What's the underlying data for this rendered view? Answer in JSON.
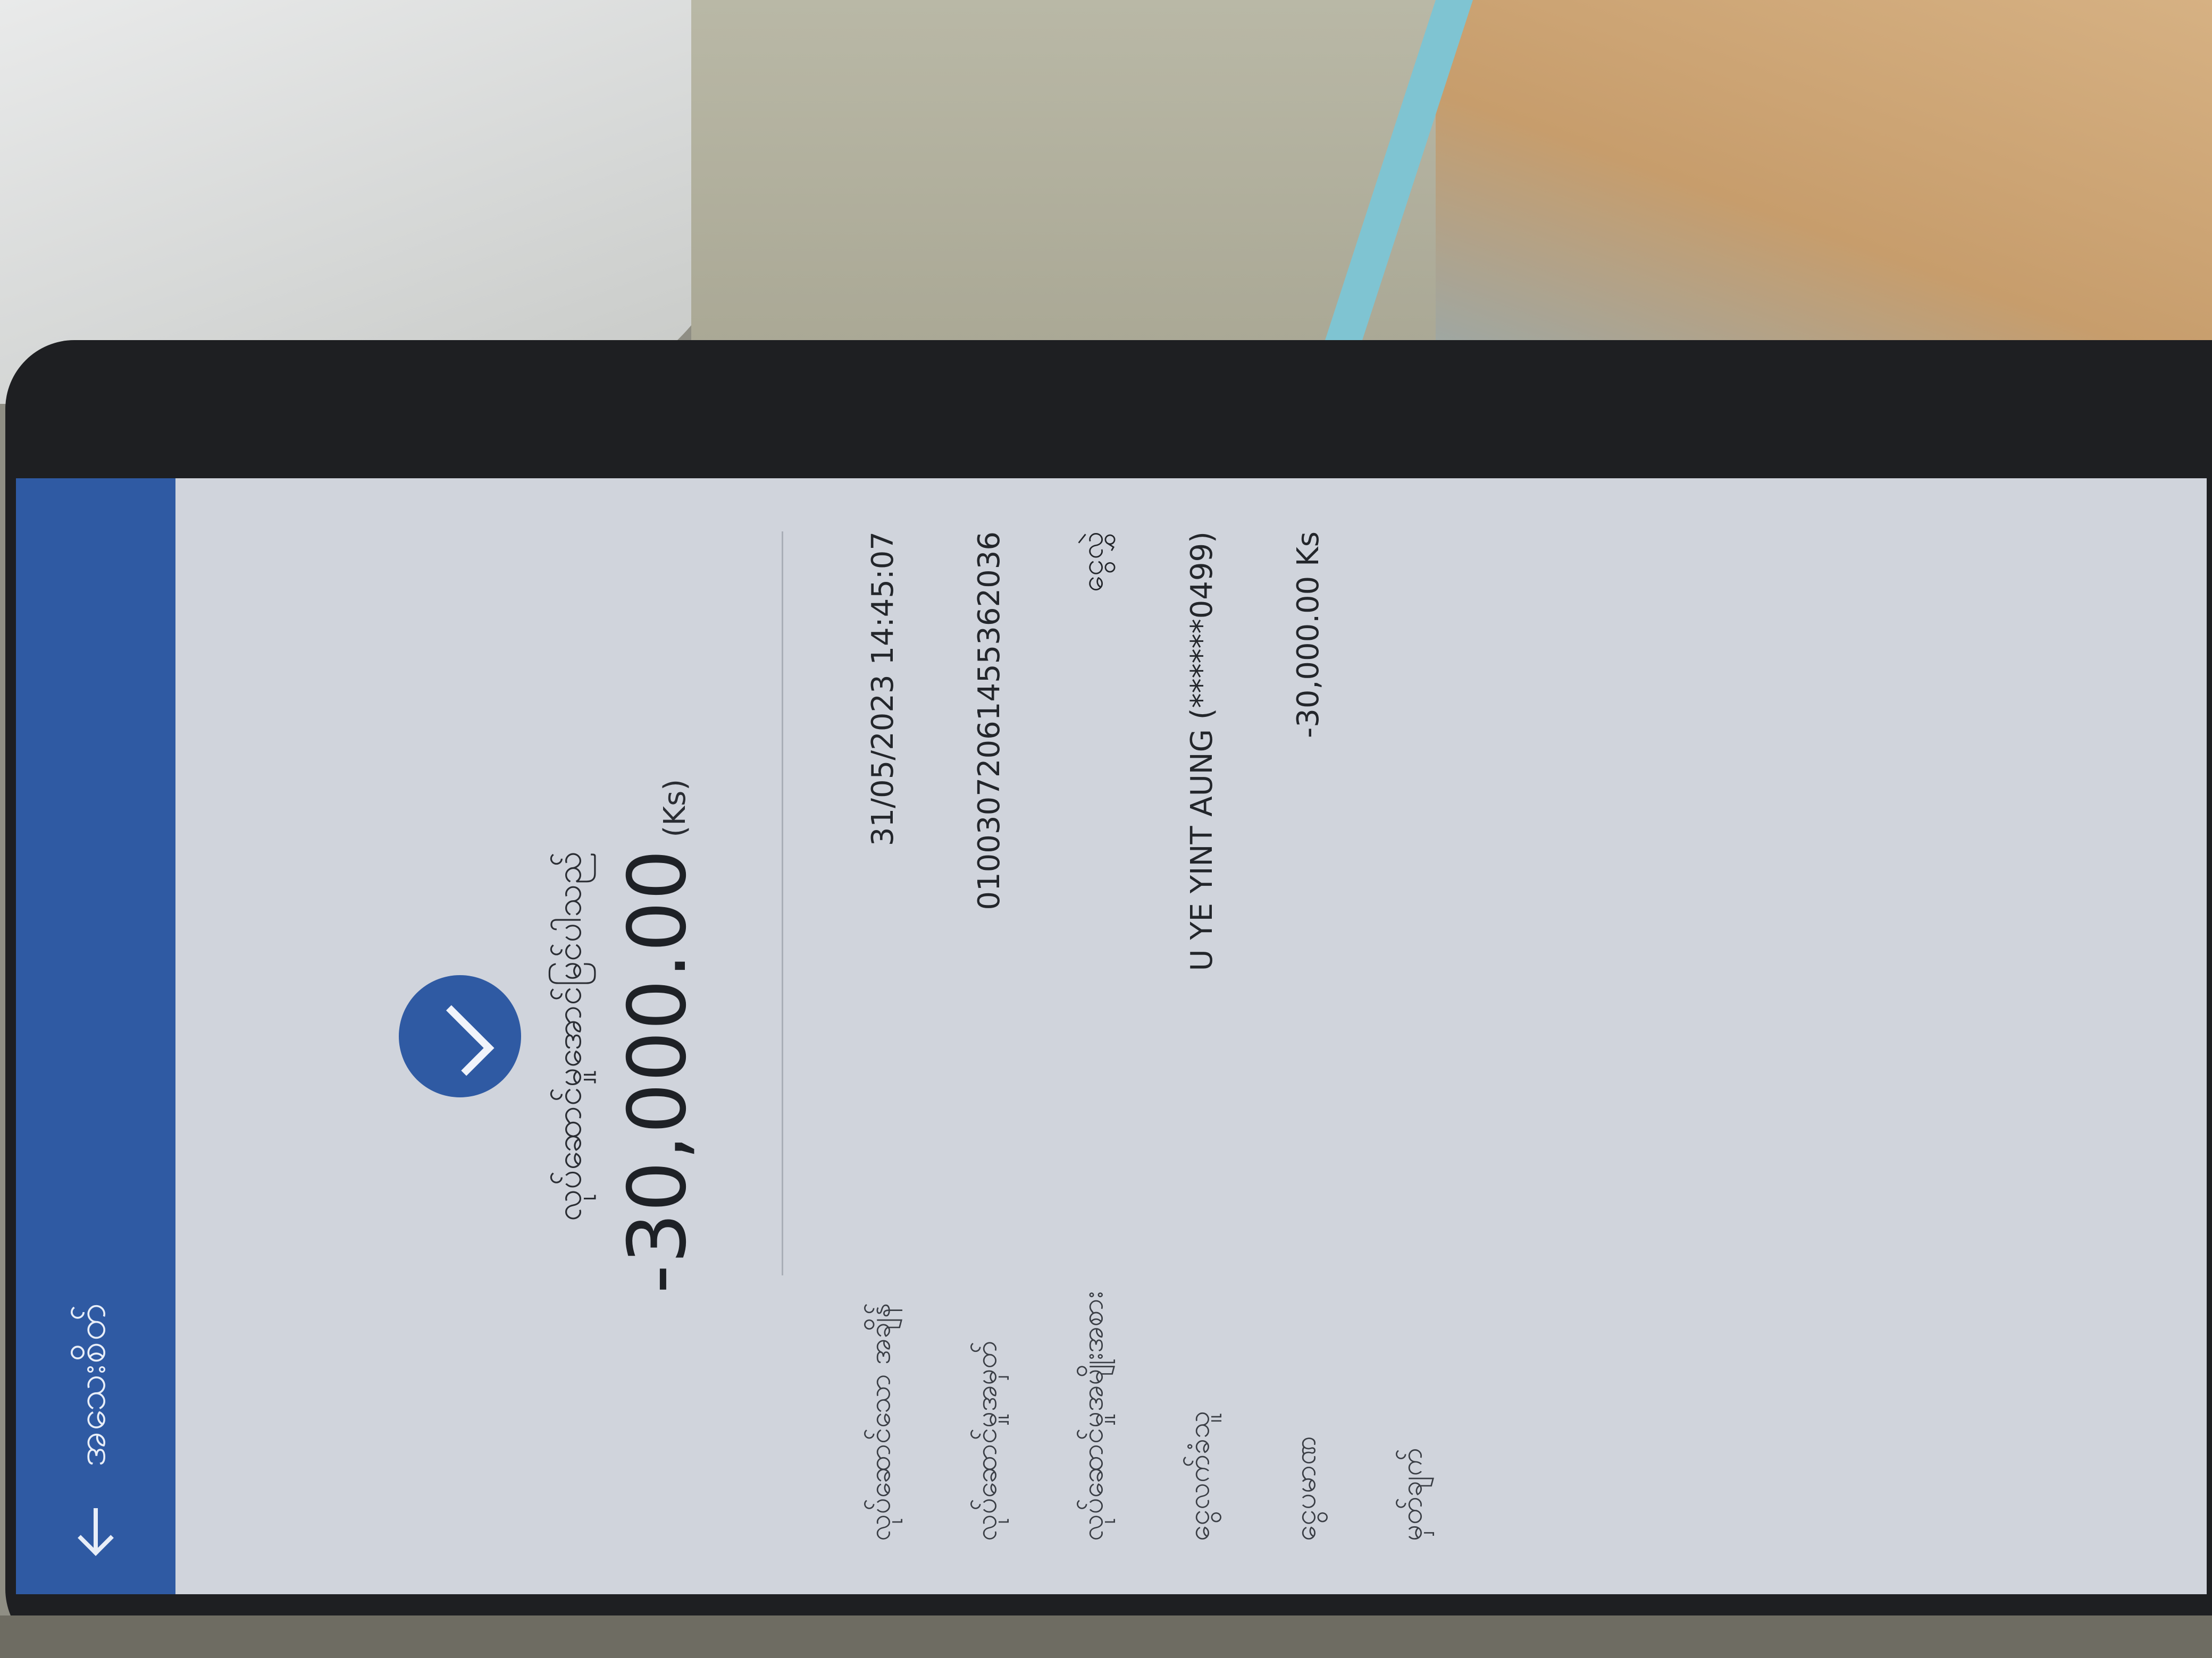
{
  "app": {
    "back_icon": "arrow-left-icon",
    "title": "အသေးစိတ်"
  },
  "status": {
    "icon": "check-icon",
    "message": "လုပ်ဆောင်မှုအောင်မြင်ပါသည်",
    "amount": "-30,000.00",
    "currency": "(Ks)"
  },
  "details": [
    {
      "label": "လုပ်ဆောင်သော အချိန်",
      "value": "31/05/2023 14:45:07"
    },
    {
      "label": "လုပ်ဆောင်မှုအမှတ်",
      "value": "01003072061455362036"
    },
    {
      "label": "လုပ်ဆောင်မှုအမျိုးအစား",
      "value": "ငွေလွှဲ"
    },
    {
      "label": "ငွေလက်ခံသူ",
      "value": "U YE YINT AUNG (******0499)"
    },
    {
      "label": "ငွေပမာဏ",
      "value": "-30,000.00 Ks"
    },
    {
      "label": "မှတ်ချက်",
      "value": ""
    }
  ],
  "colors": {
    "accent": "#2f5aa3",
    "screen_bg": "#d0d4dc"
  }
}
